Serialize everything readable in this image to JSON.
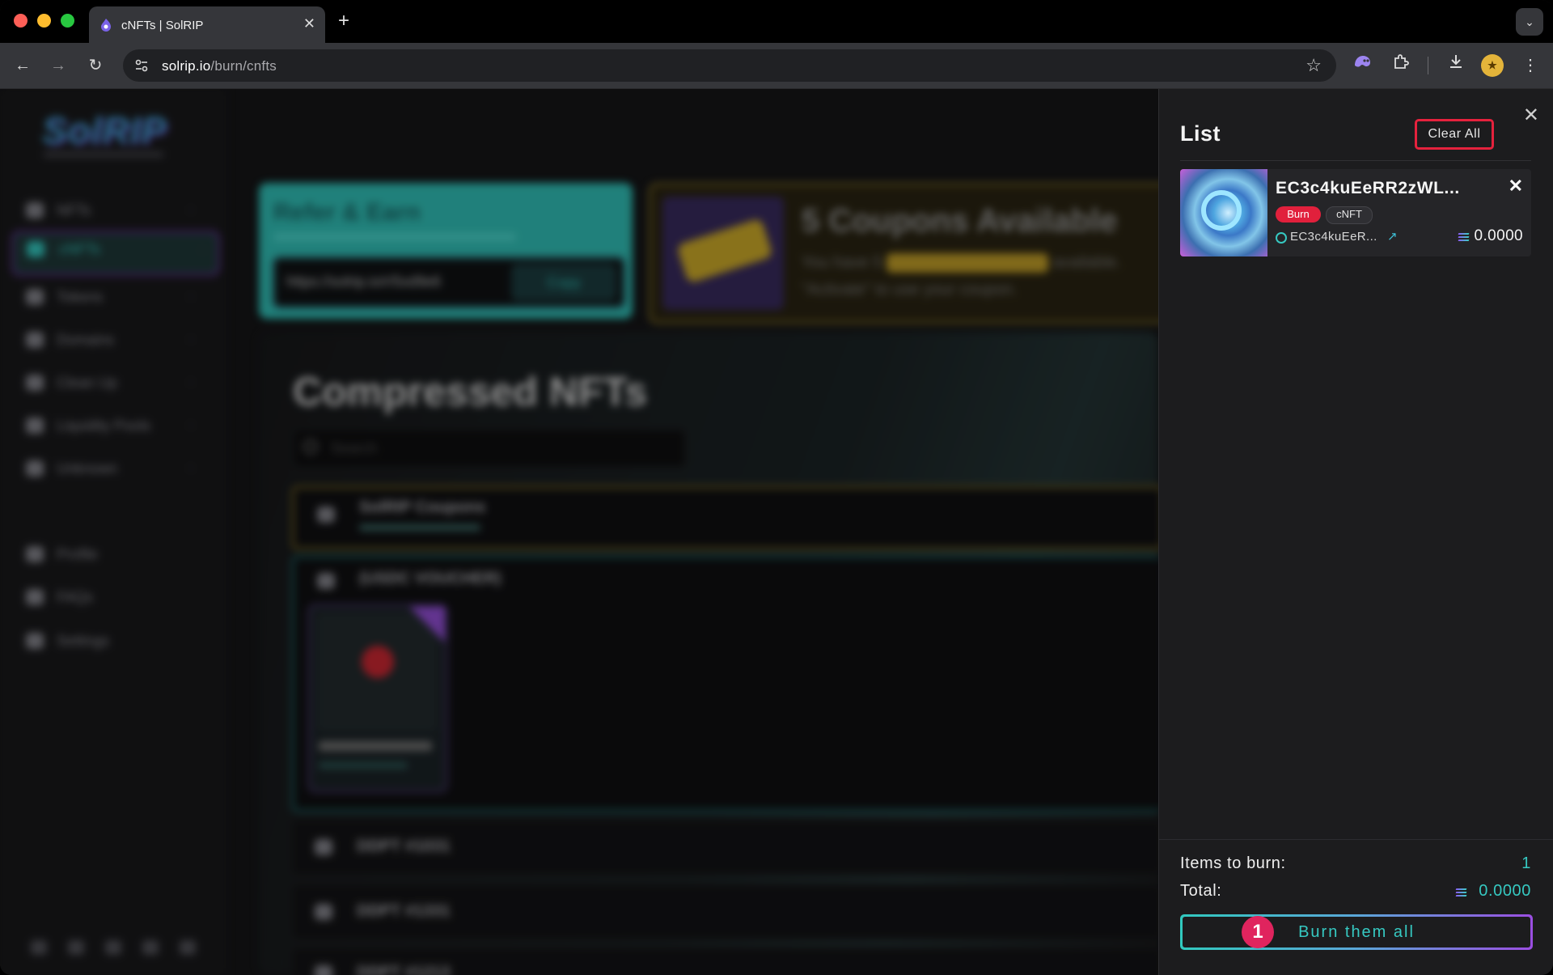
{
  "browser": {
    "tab_title": "cNFTs | SolRIP",
    "close_tab": "✕",
    "new_tab": "+",
    "url_host": "solrip.io",
    "url_path": "/burn/cnfts"
  },
  "page": {
    "logo": "SolRIP",
    "sidebar": {
      "items": [
        {
          "label": "NFTs"
        },
        {
          "label": "cNFTs"
        },
        {
          "label": "Tokens"
        },
        {
          "label": "Domains"
        },
        {
          "label": "Clean Up"
        },
        {
          "label": "Liquidity Pools"
        },
        {
          "label": "Unknown"
        }
      ],
      "bottom_items": [
        {
          "label": "Profile"
        },
        {
          "label": "FAQs"
        },
        {
          "label": "Settings"
        }
      ]
    },
    "refer": {
      "title": "Refer & Earn",
      "link": "https://solrip.io/r/5xd9e6",
      "copy_label": "Copy"
    },
    "coupons": {
      "title": "5 Coupons Available",
      "line1_pre": "You have 5",
      "line1_post": "available.",
      "line2": "\"Activate\" to use your coupon."
    },
    "heading": "Compressed NFTs",
    "search_placeholder": "Search",
    "collections": [
      {
        "name": "SolRIP Coupons"
      },
      {
        "name": "(USDC VOUCHER)"
      },
      {
        "name": "DDPT #1031"
      },
      {
        "name": "DDPT #1331"
      },
      {
        "name": "DDPT #1213"
      }
    ]
  },
  "panel": {
    "title": "List",
    "clear_all": "Clear All",
    "items": [
      {
        "name": "EC3c4kuEeRR2zWL...",
        "badge_burn": "Burn",
        "badge_type": "cNFT",
        "address": "EC3c4kuEeR...",
        "value": "0.0000"
      }
    ],
    "items_to_burn_label": "Items to burn:",
    "items_to_burn_value": "1",
    "total_label": "Total:",
    "total_value": "0.0000",
    "burn_button": "Burn them all",
    "step_marker": "1"
  }
}
